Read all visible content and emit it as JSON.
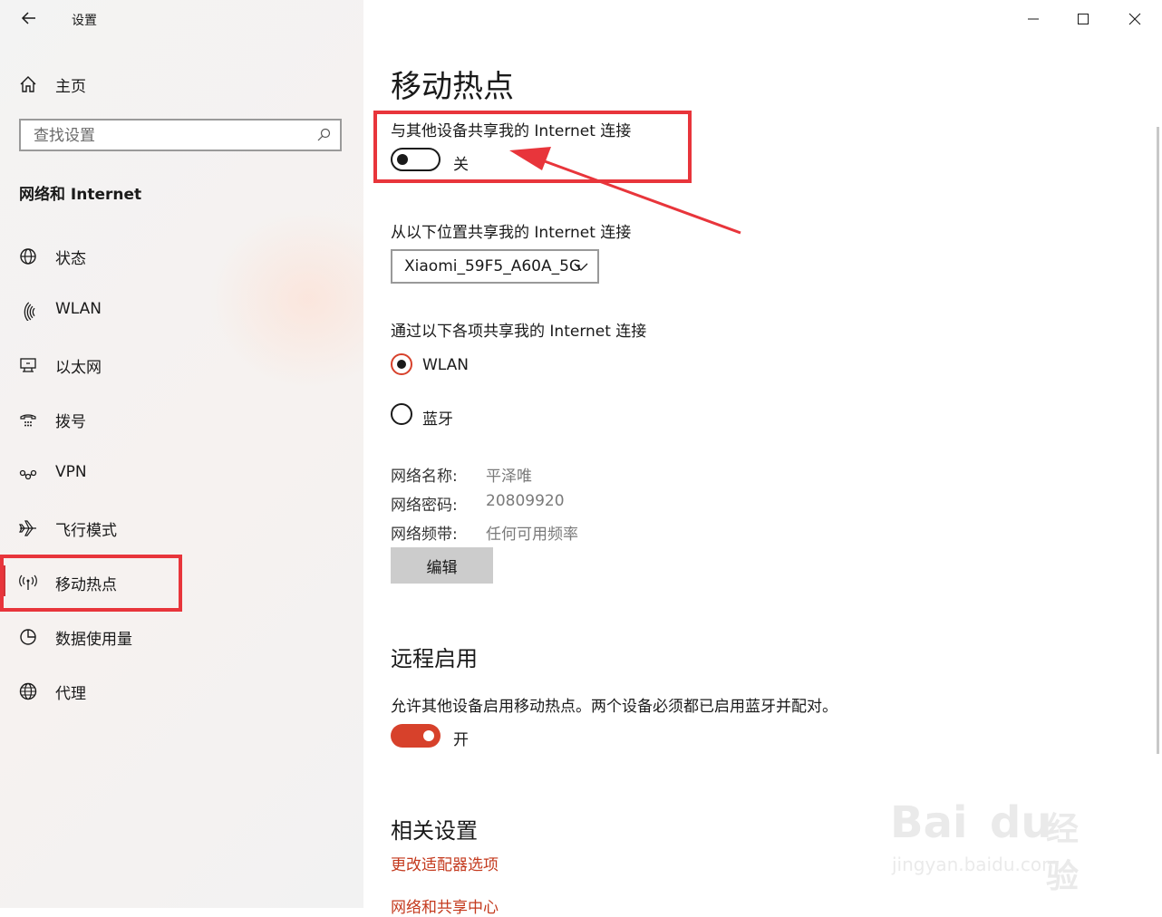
{
  "window": {
    "title": "设置",
    "controls": [
      "minimize-icon",
      "maximize-icon",
      "close-icon"
    ]
  },
  "sidebar": {
    "home_label": "主页",
    "search_placeholder": "查找设置",
    "section_title": "网络和 Internet",
    "items": [
      {
        "label": "状态",
        "icon": "status-globe-icon"
      },
      {
        "label": "WLAN",
        "icon": "wifi-icon"
      },
      {
        "label": "以太网",
        "icon": "ethernet-icon"
      },
      {
        "label": "拨号",
        "icon": "dialup-icon"
      },
      {
        "label": "VPN",
        "icon": "vpn-icon"
      },
      {
        "label": "飞行模式",
        "icon": "airplane-icon"
      },
      {
        "label": "移动热点",
        "icon": "hotspot-icon",
        "active": true
      },
      {
        "label": "数据使用量",
        "icon": "data-usage-icon"
      },
      {
        "label": "代理",
        "icon": "proxy-globe-icon"
      }
    ]
  },
  "main": {
    "page_title": "移动热点",
    "share_label": "与其他设备共享我的 Internet 连接",
    "share_toggle": {
      "state": "关",
      "on": false
    },
    "from_label": "从以下位置共享我的 Internet 连接",
    "from_value": "Xiaomi_59F5_A60A_5G",
    "via_label": "通过以下各项共享我的 Internet 连接",
    "via_options": [
      {
        "label": "WLAN",
        "selected": true
      },
      {
        "label": "蓝牙",
        "selected": false
      }
    ],
    "info": [
      {
        "key": "网络名称:",
        "value": "平泽唯"
      },
      {
        "key": "网络密码:",
        "value": "20809920"
      },
      {
        "key": "网络频带:",
        "value": "任何可用频率"
      }
    ],
    "edit_button": "编辑",
    "remote_title": "远程启用",
    "remote_desc": "允许其他设备启用移动热点。两个设备必须都已启用蓝牙并配对。",
    "remote_toggle": {
      "state": "开",
      "on": true
    },
    "related_title": "相关设置",
    "related_links": [
      "更改适配器选项",
      "网络和共享中心"
    ]
  },
  "colors": {
    "accent": "#d7412b",
    "annotation_red": "#e8353b",
    "link": "#c43a1e"
  },
  "watermark": {
    "brand": "Bai",
    "brand2": "du",
    "suffix": "经验",
    "url": "jingyan.baidu.com"
  }
}
